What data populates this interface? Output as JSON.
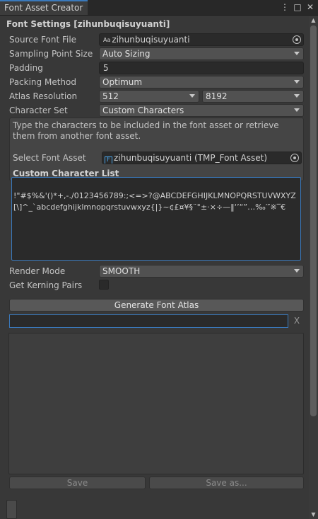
{
  "window": {
    "tab_title": "Font Asset Creator",
    "menu_icon": "kebab-menu-icon",
    "maximize_icon": "maximize-icon",
    "close_icon": "close-icon"
  },
  "settings": {
    "section_title": "Font Settings [zihunbuqisuyuanti]",
    "source_font": {
      "label": "Source Font File",
      "icon": "Aa",
      "value": "zihunbuqisuyuanti"
    },
    "sampling_point_size": {
      "label": "Sampling Point Size",
      "value": "Auto Sizing"
    },
    "padding": {
      "label": "Padding",
      "value": "5"
    },
    "packing_method": {
      "label": "Packing Method",
      "value": "Optimum"
    },
    "atlas_resolution": {
      "label": "Atlas Resolution",
      "width": "512",
      "height": "8192"
    },
    "character_set": {
      "label": "Character Set",
      "value": "Custom Characters"
    },
    "help_text": "Type the characters to be included in the font asset or retrieve them from another font asset.",
    "select_font_asset": {
      "label": "Select Font Asset",
      "value": "zihunbuqisuyuanti (TMP_Font Asset)"
    },
    "custom_character_list": {
      "label": "Custom Character List",
      "value": "!\"#$%&'()*+,-./0123456789:;<=>?@ABCDEFGHIJKLMNOPQRSTUVWXYZ[\\]^_`abcdefghijklmnopqrstuvwxyz{|}~¢£¤¥§¨°±·×÷—‖‘’“”…‰′″※‾€"
    },
    "render_mode": {
      "label": "Render Mode",
      "value": "SMOOTH"
    },
    "kerning": {
      "label": "Get Kerning Pairs",
      "checked": false
    }
  },
  "actions": {
    "generate_label": "Generate Font Atlas",
    "clear_label": "X",
    "progress": 0,
    "save_label": "Save",
    "save_as_label": "Save as..."
  }
}
